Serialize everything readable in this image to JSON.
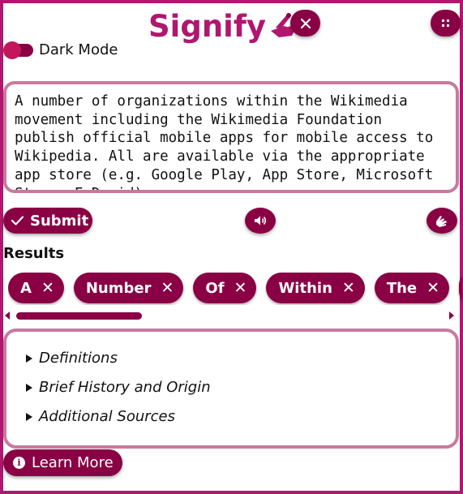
{
  "header": {
    "logo_text": "Signify",
    "logo_icon": "signing-hand-icon",
    "close_icon": "close-icon",
    "menu_icon": "grid-menu-icon"
  },
  "settings": {
    "dark_mode_label": "Dark Mode",
    "dark_mode_on": false
  },
  "input": {
    "text": "A number of organizations within the Wikimedia movement including the Wikimedia Foundation publish official mobile apps for mobile access to Wikipedia. All are available via the appropriate app store (e.g. Google Play, App Store, Microsoft Store, F-Droid)."
  },
  "actions": {
    "submit_label": "Submit",
    "submit_icon": "checkmark-icon",
    "speak_icon": "speaker-icon",
    "sign_icon": "sign-hand-icon"
  },
  "results": {
    "title": "Results",
    "chips": [
      "A",
      "Number",
      "Of",
      "Within",
      "The"
    ],
    "chip_remove_glyph": "✕"
  },
  "details": {
    "items": [
      "Definitions",
      "Brief History and Origin",
      "Additional Sources"
    ]
  },
  "footer": {
    "learn_more_label": "Learn More",
    "learn_more_icon": "info-icon"
  },
  "colors": {
    "brand": "#b0176f",
    "button": "#8a0044",
    "border_soft": "#c87a9d"
  }
}
